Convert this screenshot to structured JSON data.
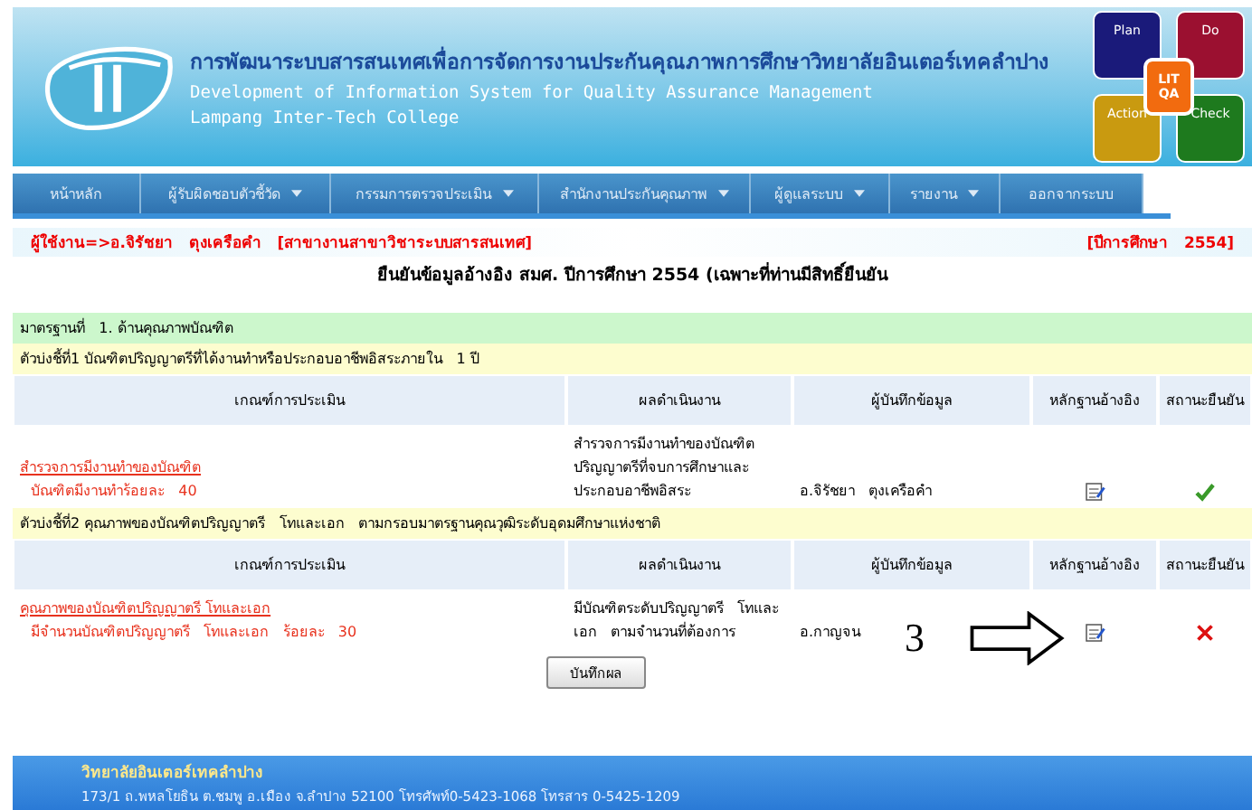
{
  "header": {
    "title_th": "การพัฒนาระบบสารสนเทศเพื่อการจัดการงานประกันคุณภาพการศึกษาวิทยาลัยอินเตอร์เทคลำปาง",
    "title_en": "Development of Information System for Quality Assurance Management",
    "college": "Lampang Inter-Tech College",
    "pdca": [
      {
        "kind": "plan",
        "label": "Plan"
      },
      {
        "kind": "do",
        "label": "Do"
      },
      {
        "kind": "action",
        "label": "Action"
      },
      {
        "kind": "check",
        "label": "Check"
      }
    ],
    "center_top": "LIT",
    "center_bottom": "QA"
  },
  "menu": [
    {
      "label": "หน้าหลัก",
      "dropdown": false
    },
    {
      "label": "ผู้รับผิดชอบตัวชี้วัด",
      "dropdown": true
    },
    {
      "label": "กรรมการตรวจประเมิน",
      "dropdown": true
    },
    {
      "label": "สำนักงานประกันคุณภาพ",
      "dropdown": true
    },
    {
      "label": "ผู้ดูแลระบบ",
      "dropdown": true
    },
    {
      "label": "รายงาน",
      "dropdown": true
    },
    {
      "label": "ออกจากระบบ",
      "dropdown": false
    }
  ],
  "user_line": "ผู้ใช้งาน=>อ.จิรัชยา   ตุงเครือคำ   [สาขางานสาขาวิชาระบบสารสนเทศ]",
  "year": "[ปีการศึกษา   2554]",
  "page_title": "ยืนยันข้อมูลอ้างอิง สมศ. ปีการศึกษา 2554 (เฉพาะที่ท่านมีสิทธิ์ยืนยัน",
  "standard": "มาตรฐานที่   1. ด้านคุณภาพบัณฑิต",
  "indicators": [
    {
      "title": "ตัวบ่งชี้ที่1 บัณฑิตปริญญาตรีที่ได้งานทำหรือประกอบอาชีพอิสระภายใน   1 ปี",
      "columns": [
        "เกณฑ์การประเมิน",
        "ผลดำเนินงาน",
        "ผู้บันทึกข้อมูล",
        "หลักฐานอ้างอิง",
        "สถานะยืนยัน"
      ],
      "rows": [
        {
          "criterion": "สำรวจการมีงานทำของบัณฑิต",
          "detail": "บัณฑิตมีงานทำร้อยละ   40",
          "result": "สำรวจการมีงานทำของบัณฑิตปริญญาตรีที่จบการศึกษาและประกอบอาชีพอิสระ",
          "recorder": "อ.จิรัชยา   ตุงเครือคำ",
          "confirmed": true
        }
      ]
    },
    {
      "title": "ตัวบ่งชี้ที่2 คุณภาพของบัณฑิตปริญญาตรี   โทและเอก   ตามกรอบมาตรฐานคุณวุฒิระดับอุดมศึกษาแห่งชาติ",
      "columns": [
        "เกณฑ์การประเมิน",
        "ผลดำเนินงาน",
        "ผู้บันทึกข้อมูล",
        "หลักฐานอ้างอิง",
        "สถานะยืนยัน"
      ],
      "rows": [
        {
          "criterion": "คุณภาพของบัณฑิตปริญญาตรี   โทและเอก",
          "detail": "มีจำนวนบัณฑิตปริญญาตรี   โทและเอก   ร้อยละ   30",
          "result": "มีบัณฑิตระดับปริญญาตรี   โทและเอก   ตามจำนวนที่ต้องการ",
          "recorder": "อ.กาญจน",
          "confirmed": false
        }
      ]
    }
  ],
  "annotation": "3",
  "save_button": "บันทึกผล",
  "footer": {
    "name": "วิทยาลัยอินเตอร์เทคลำปาง",
    "address": "173/1 ถ.พหลโยธิน ต.ชมพู อ.เมือง จ.ลำปาง 52100 โทรศัพท์0-5423-1068 โทรสาร 0-5425-1209"
  }
}
